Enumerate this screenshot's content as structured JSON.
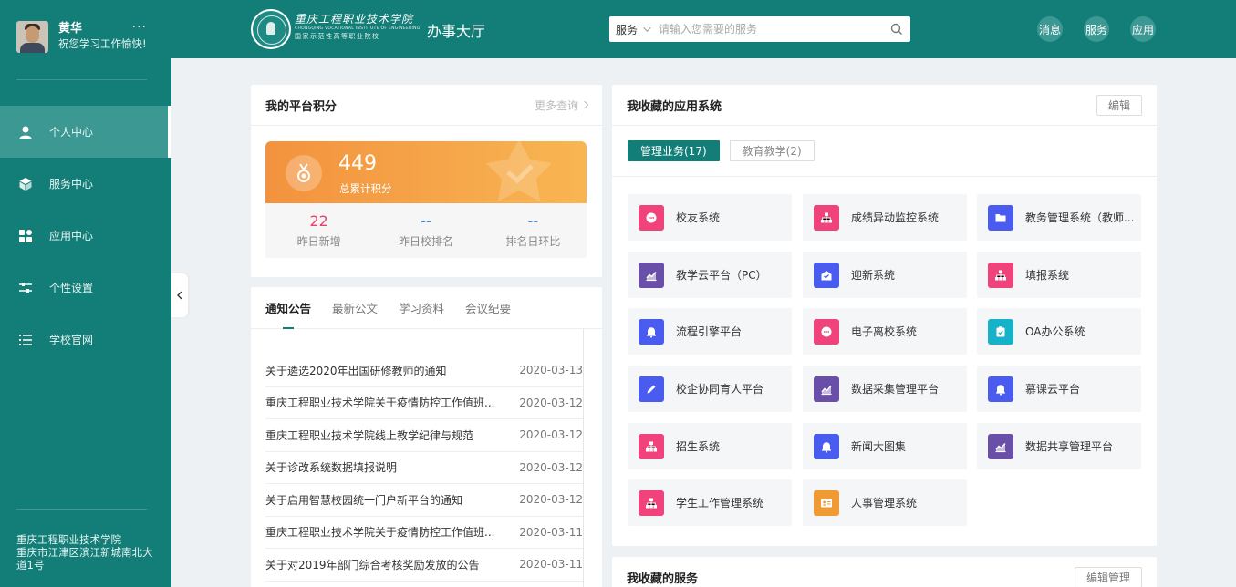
{
  "user": {
    "name": "黄华",
    "greeting": "祝您学习工作愉快!",
    "more": "···"
  },
  "nav": [
    {
      "label": "个人中心",
      "icon": "user-icon",
      "active": true
    },
    {
      "label": "服务中心",
      "icon": "cube-icon",
      "active": false
    },
    {
      "label": "应用中心",
      "icon": "apps-icon",
      "active": false
    },
    {
      "label": "个性设置",
      "icon": "sliders-icon",
      "active": false
    },
    {
      "label": "学校官网",
      "icon": "list-icon",
      "active": false
    }
  ],
  "footer": {
    "school": "重庆工程职业技术学院",
    "address": "重庆市江津区滨江新城南北大道1号"
  },
  "header": {
    "logo_cn": "重庆工程职业技术学院",
    "logo_en": "CHONGQING VOCATIONAL INSTITUTE OF ENGINEERING",
    "logo_sub": "国家示范性高等职业院校",
    "title": "办事大厅",
    "search_scope": "服务",
    "search_placeholder": "请输入您需要的服务",
    "buttons": [
      "消息",
      "服务",
      "应用"
    ]
  },
  "points": {
    "title": "我的平台积分",
    "more": "更多查询",
    "total": "449",
    "total_label": "总累计积分",
    "stats": [
      {
        "value": "22",
        "label": "昨日新增",
        "color": "#e8436a"
      },
      {
        "value": "--",
        "label": "昨日校排名",
        "color": "#3c8ee8"
      },
      {
        "value": "--",
        "label": "排名日环比",
        "color": "#3c8ee8"
      }
    ]
  },
  "notices": {
    "tabs": [
      "通知公告",
      "最新公文",
      "学习资料",
      "会议纪要"
    ],
    "items": [
      {
        "title": "关于遴选2020年出国研修教师的通知",
        "date": "2020-03-13"
      },
      {
        "title": "重庆工程职业技术学院关于疫情防控工作值班...",
        "date": "2020-03-12"
      },
      {
        "title": "重庆工程职业技术学院线上教学纪律与规范",
        "date": "2020-03-12"
      },
      {
        "title": "关于诊改系统数据填报说明",
        "date": "2020-03-12"
      },
      {
        "title": "关于启用智慧校园统一门户新平台的通知",
        "date": "2020-03-12"
      },
      {
        "title": "重庆工程职业技术学院关于疫情防控工作值班...",
        "date": "2020-03-11"
      },
      {
        "title": "关于对2019年部门综合考核奖励发放的公告",
        "date": "2020-03-11"
      }
    ]
  },
  "apps": {
    "title": "我收藏的应用系统",
    "edit": "编辑",
    "categories": [
      "管理业务(17)",
      "教育教学(2)"
    ],
    "items": [
      {
        "name": "校友系统",
        "color": "#f0427b",
        "icon": "chat-icon"
      },
      {
        "name": "成绩异动监控系统",
        "color": "#f0427b",
        "icon": "org-chart-icon"
      },
      {
        "name": "教务管理系统（教师...",
        "color": "#4a5cf0",
        "icon": "folder-icon"
      },
      {
        "name": "教学云平台（PC）",
        "color": "#6a4fa8",
        "icon": "chart-icon"
      },
      {
        "name": "迎新系统",
        "color": "#4a5cf0",
        "icon": "envelope-open-icon"
      },
      {
        "name": "填报系统",
        "color": "#f0427b",
        "icon": "org-chart-icon"
      },
      {
        "name": "流程引擎平台",
        "color": "#4a5cf0",
        "icon": "bell-icon"
      },
      {
        "name": "电子离校系统",
        "color": "#f0427b",
        "icon": "chat-icon"
      },
      {
        "name": "OA办公系统",
        "color": "#16b2c9",
        "icon": "clipboard-check-icon"
      },
      {
        "name": "校企协同育人平台",
        "color": "#4a5cf0",
        "icon": "pencil-icon"
      },
      {
        "name": "数据采集管理平台",
        "color": "#6a4fa8",
        "icon": "chart-icon"
      },
      {
        "name": "慕课云平台",
        "color": "#4a5cf0",
        "icon": "bell-icon"
      },
      {
        "name": "招生系统",
        "color": "#f0427b",
        "icon": "org-chart-icon"
      },
      {
        "name": "新闻大图集",
        "color": "#4a5cf0",
        "icon": "bell-icon"
      },
      {
        "name": "数据共享管理平台",
        "color": "#6a4fa8",
        "icon": "chart-icon"
      },
      {
        "name": "学生工作管理系统",
        "color": "#f0427b",
        "icon": "org-chart-icon"
      },
      {
        "name": "人事管理系统",
        "color": "#f09a33",
        "icon": "id-card-icon"
      }
    ]
  },
  "services": {
    "title": "我收藏的服务",
    "edit": "编辑管理"
  }
}
